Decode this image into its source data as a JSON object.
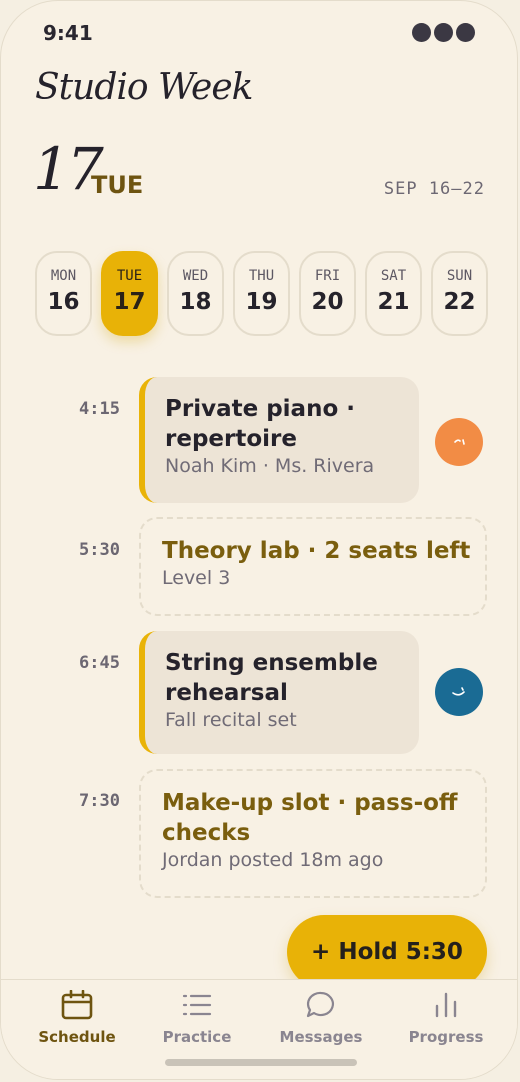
{
  "status": {
    "time": "9:41"
  },
  "header": {
    "title": "Studio Week",
    "day_number": "17",
    "day_name": "TUE",
    "range": "SEP 16–22"
  },
  "week": [
    {
      "name": "MON",
      "num": "16"
    },
    {
      "name": "TUE",
      "num": "17",
      "selected": true
    },
    {
      "name": "WED",
      "num": "18"
    },
    {
      "name": "THU",
      "num": "19"
    },
    {
      "name": "FRI",
      "num": "20"
    },
    {
      "name": "SAT",
      "num": "21"
    },
    {
      "name": "SUN",
      "num": "22"
    }
  ],
  "slots": [
    {
      "time": "4:15",
      "type": "booked",
      "title": "Private piano · repertoire",
      "subtitle": "Noah Kim · Ms. Rivera",
      "avatar_color": "#f28c45"
    },
    {
      "time": "5:30",
      "type": "open",
      "title": "Theory lab · 2 seats left",
      "subtitle": "Level 3"
    },
    {
      "time": "6:45",
      "type": "booked",
      "title": "String ensemble rehearsal",
      "subtitle": "Fall recital set",
      "avatar_color": "#1a6b94"
    },
    {
      "time": "7:30",
      "type": "open",
      "title": "Make-up slot · pass-off checks",
      "subtitle": "Jordan posted 18m ago"
    }
  ],
  "fab": {
    "label": "+ Hold 5:30"
  },
  "tabs": [
    {
      "label": "Schedule",
      "icon": "calendar-icon",
      "active": true
    },
    {
      "label": "Practice",
      "icon": "list-icon"
    },
    {
      "label": "Messages",
      "icon": "chat-bubble-icon"
    },
    {
      "label": "Progress",
      "icon": "bar-chart-icon"
    }
  ],
  "colors": {
    "accent": "#e8b207",
    "background": "#f8f1e4",
    "card": "#ede4d6",
    "accent_text": "#6e5410"
  }
}
